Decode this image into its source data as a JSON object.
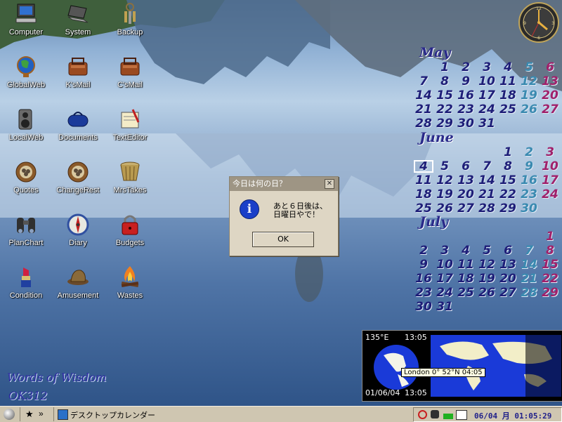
{
  "desktop_icons": [
    {
      "label": "Computer",
      "icon": "computer-icon"
    },
    {
      "label": "System",
      "icon": "laptop-icon"
    },
    {
      "label": "Backup",
      "icon": "keys-icon"
    },
    {
      "label": "GlobalWeb",
      "icon": "globe-icon"
    },
    {
      "label": "K'sMail",
      "icon": "mail-bag-icon"
    },
    {
      "label": "C'sMail",
      "icon": "mail-bag-icon"
    },
    {
      "label": "LocalWeb",
      "icon": "speaker-icon"
    },
    {
      "label": "Documents",
      "icon": "duffel-bag-icon"
    },
    {
      "label": "TextEditor",
      "icon": "notepad-icon"
    },
    {
      "label": "Quotes",
      "icon": "nest-icon"
    },
    {
      "label": "ChangeRest",
      "icon": "nest-icon"
    },
    {
      "label": "MrsTakes",
      "icon": "basket-icon"
    },
    {
      "label": "PlanChart",
      "icon": "binoculars-icon"
    },
    {
      "label": "Diary",
      "icon": "compass-icon"
    },
    {
      "label": "Budgets",
      "icon": "padlock-icon"
    },
    {
      "label": "Condition",
      "icon": "lipstick-icon"
    },
    {
      "label": "Amusement",
      "icon": "hat-icon"
    },
    {
      "label": "Wastes",
      "icon": "campfire-icon"
    }
  ],
  "words_of_wisdom": {
    "line1": "Words of Wisdom",
    "line2": "OK312"
  },
  "calendar": {
    "months": [
      {
        "name": "May",
        "weeks": [
          [
            "",
            "1",
            "2",
            "3",
            "4",
            "5",
            "6"
          ],
          [
            "7",
            "8",
            "9",
            "10",
            "11",
            "12",
            "13"
          ],
          [
            "14",
            "15",
            "16",
            "17",
            "18",
            "19",
            "20"
          ],
          [
            "21",
            "22",
            "23",
            "24",
            "25",
            "26",
            "27"
          ],
          [
            "28",
            "29",
            "30",
            "31",
            "",
            "",
            ""
          ]
        ]
      },
      {
        "name": "June",
        "weeks": [
          [
            "",
            "",
            "",
            "",
            "1",
            "2",
            "3"
          ],
          [
            "4",
            "5",
            "6",
            "7",
            "8",
            "9",
            "10"
          ],
          [
            "11",
            "12",
            "13",
            "14",
            "15",
            "16",
            "17"
          ],
          [
            "18",
            "19",
            "20",
            "21",
            "22",
            "23",
            "24"
          ],
          [
            "25",
            "26",
            "27",
            "28",
            "29",
            "30",
            ""
          ]
        ]
      },
      {
        "name": "July",
        "weeks": [
          [
            "",
            "",
            "",
            "",
            "",
            "",
            "1"
          ],
          [
            "2",
            "3",
            "4",
            "5",
            "6",
            "7",
            "8"
          ],
          [
            "9",
            "10",
            "11",
            "12",
            "13",
            "14",
            "15"
          ],
          [
            "16",
            "17",
            "18",
            "19",
            "20",
            "21",
            "22"
          ],
          [
            "23",
            "24",
            "25",
            "26",
            "27",
            "28",
            "29"
          ],
          [
            "30",
            "31",
            "",
            "",
            "",
            "",
            ""
          ]
        ]
      }
    ],
    "today": {
      "month": "June",
      "day": "4"
    },
    "colors": {
      "weekday": "#1e1e78",
      "saturday": "#3a8ab0",
      "sunday": "#a0206a",
      "holiday": "#c03030",
      "marked": "#e8c040",
      "light": "#dde8f4"
    }
  },
  "dialog": {
    "title": "今日は何の日？",
    "close_symbol": "✕",
    "message_line1": "あと６日後は、",
    "message_line2": "日曜日やで！",
    "icon_letter": "i",
    "ok_label": "OK"
  },
  "world_clock": {
    "longitude": "135°E",
    "local_time": "13:05",
    "date": "01/06/04",
    "date_time": "13:05",
    "tooltip": "London  0°  52°N 04:05"
  },
  "taskbar": {
    "star_symbol": "★",
    "more_symbol": "»",
    "task_label": "デスクトップカレンダー",
    "clock": "06/04 月 01:05:29"
  }
}
